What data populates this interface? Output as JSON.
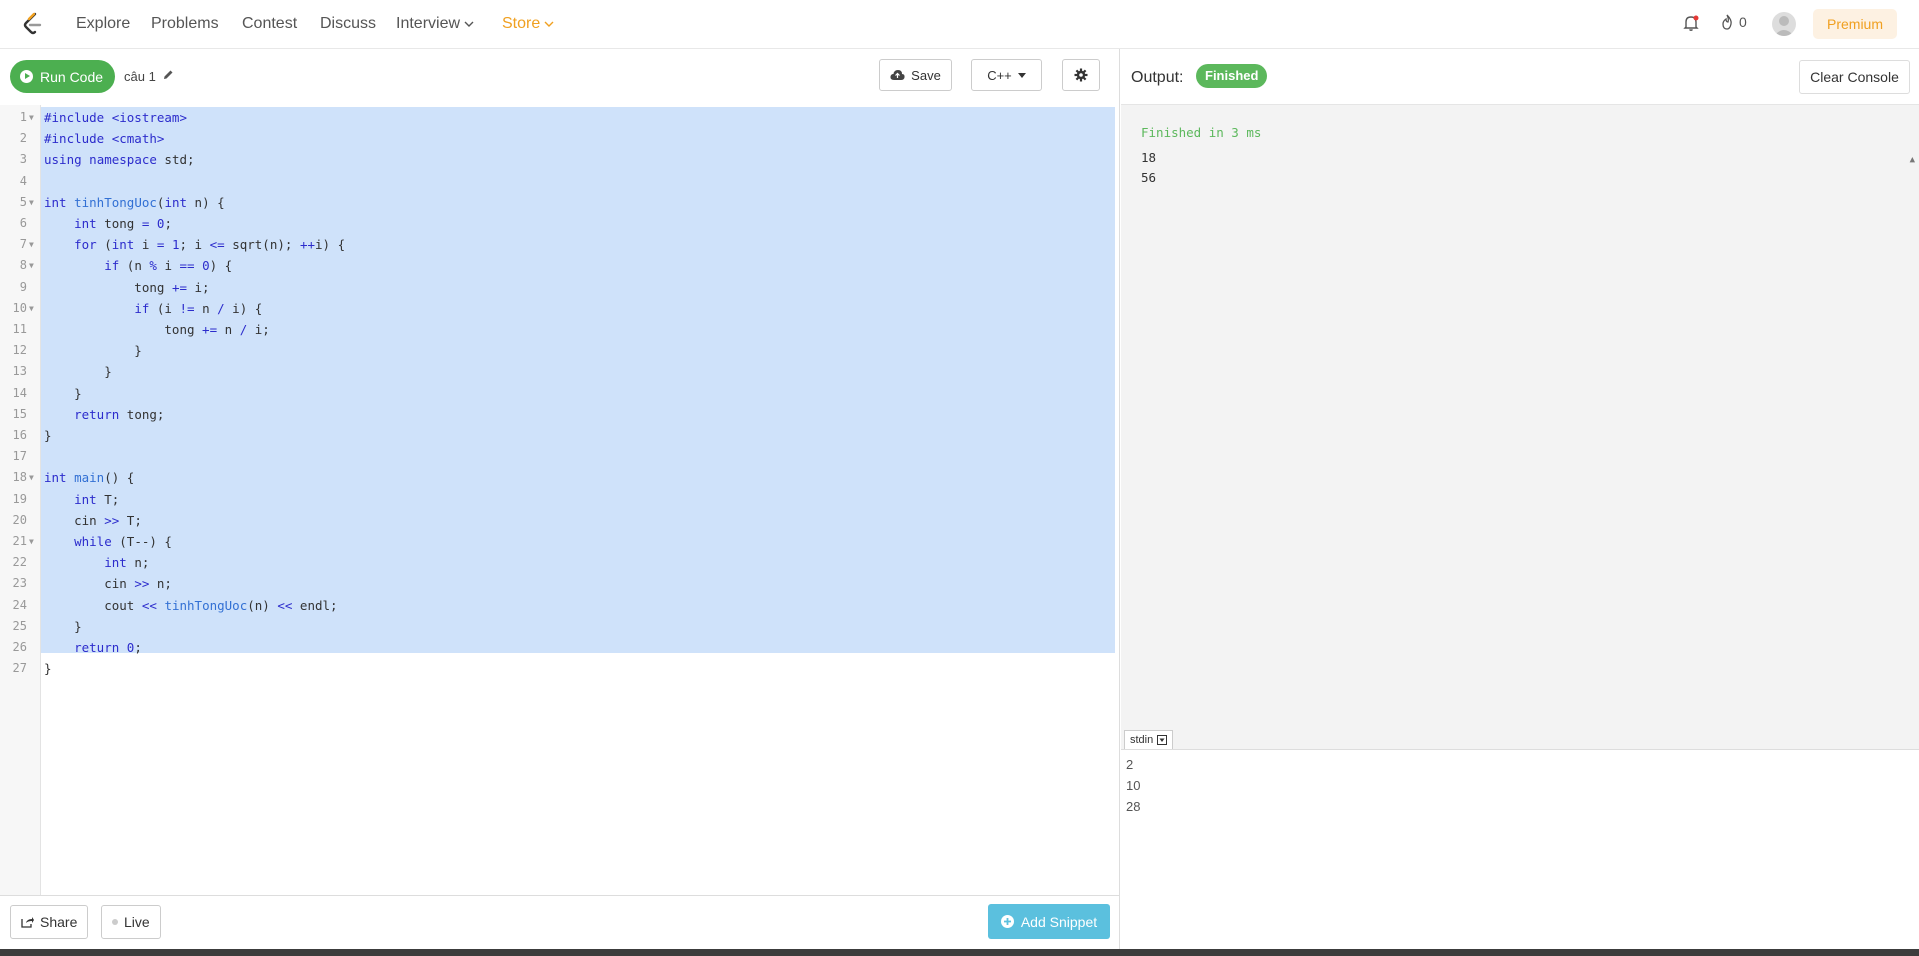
{
  "nav": {
    "items": [
      "Explore",
      "Problems",
      "Contest",
      "Discuss",
      "Interview",
      "Store"
    ],
    "streak_count": "0",
    "premium_label": "Premium",
    "store_color": "#f0a020"
  },
  "editor": {
    "run_label": "Run Code",
    "file_name": "câu 1",
    "save_label": "Save",
    "language": "C++",
    "share_label": "Share",
    "live_label": "Live",
    "snippet_label": "Add Snippet"
  },
  "code_lines": [
    "#include <iostream>",
    "#include <cmath>",
    "using namespace std;",
    "",
    "int tinhTongUoc(int n) {",
    "    int tong = 0;",
    "    for (int i = 1; i <= sqrt(n); ++i) {",
    "        if (n % i == 0) {",
    "            tong += i;",
    "            if (i != n / i) {",
    "                tong += n / i;",
    "            }",
    "        }",
    "    }",
    "    return tong;",
    "}",
    "",
    "int main() {",
    "    int T;",
    "    cin >> T;",
    "    while (T--) {",
    "        int n;",
    "        cin >> n;",
    "        cout << tinhTongUoc(n) << endl;",
    "    }",
    "    return 0;",
    "}"
  ],
  "fold_lines": [
    1,
    5,
    7,
    8,
    10,
    18,
    21
  ],
  "output": {
    "label": "Output:",
    "status": "Finished",
    "clear_label": "Clear Console",
    "status_line": "Finished in 3 ms",
    "lines": [
      "18",
      "56"
    ]
  },
  "stdin": {
    "tab_label": "stdin",
    "lines": [
      "2",
      "10",
      "28"
    ]
  }
}
